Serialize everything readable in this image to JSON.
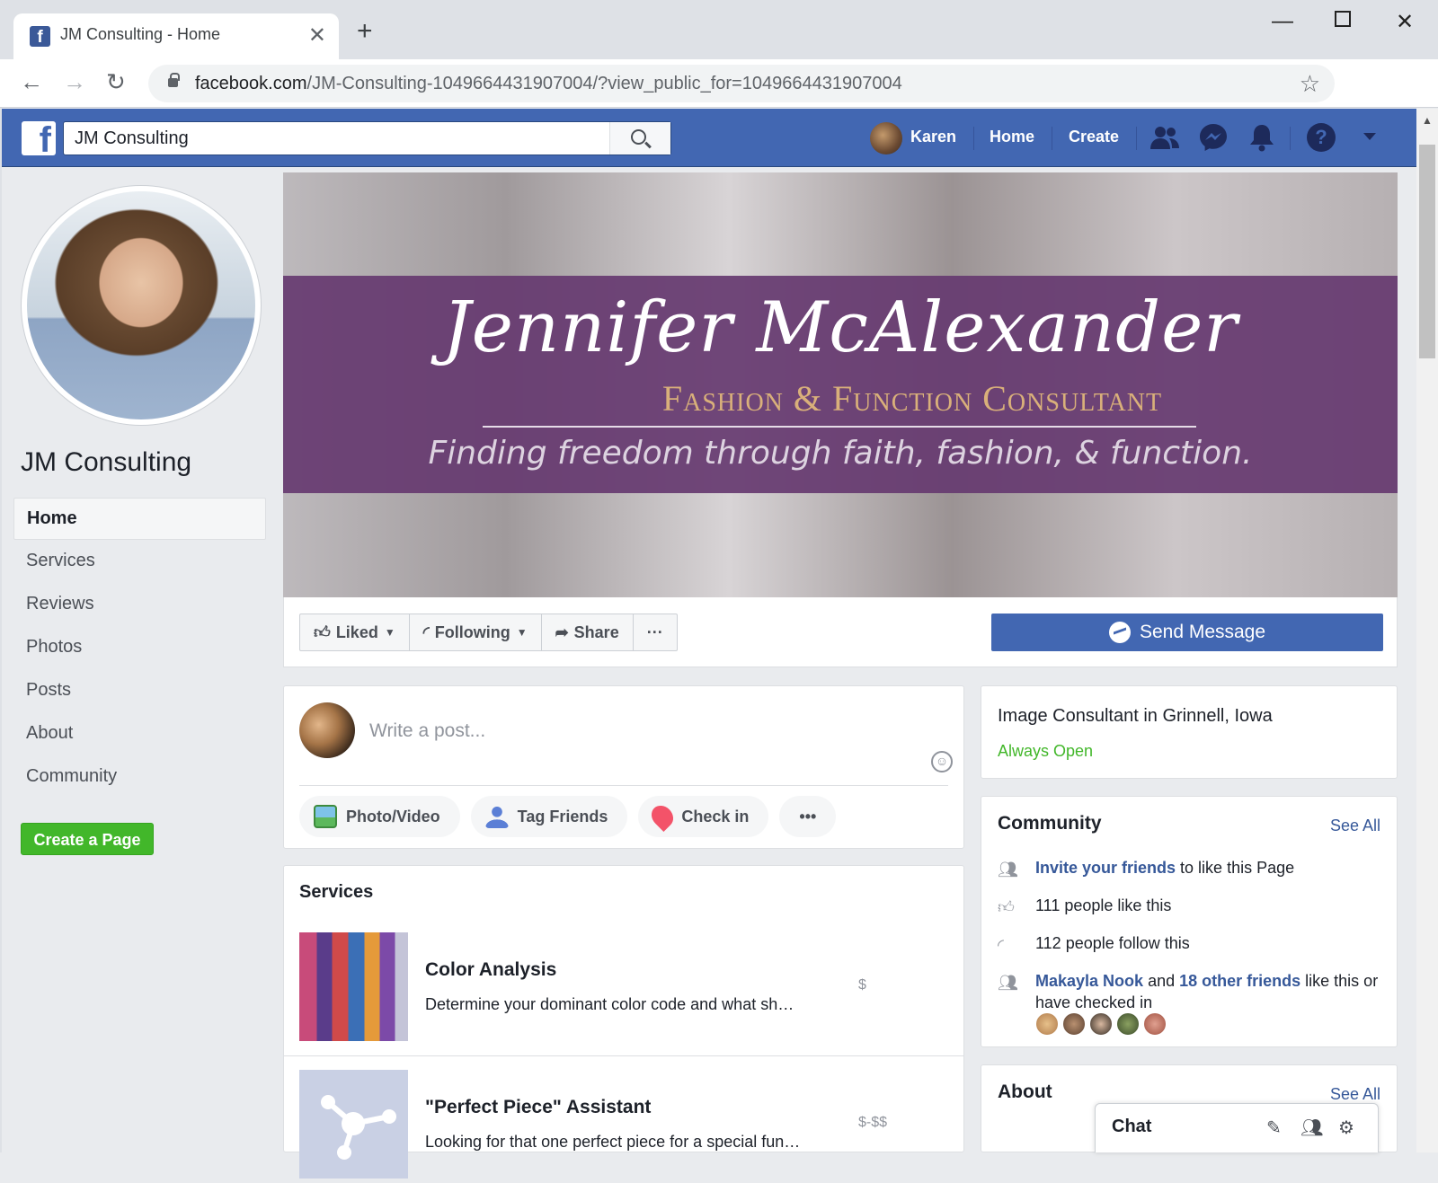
{
  "browser": {
    "tab_title": "JM Consulting - Home",
    "new_tab": "+",
    "url_host": "facebook.com",
    "url_path": "/JM-Consulting-1049664431907004/?view_public_for=1049664431907004"
  },
  "fb_header": {
    "search_value": "JM Consulting",
    "user_name": "Karen",
    "home": "Home",
    "create": "Create",
    "help": "?"
  },
  "page": {
    "name": "JM Consulting",
    "nav": [
      "Home",
      "Services",
      "Reviews",
      "Photos",
      "Posts",
      "About",
      "Community"
    ],
    "create_page": "Create a Page"
  },
  "cover": {
    "script_name": "Jennifer McAlexander",
    "subtitle": "Fashion & Function Consultant",
    "tagline": "Finding freedom through faith, fashion, & function."
  },
  "actions": {
    "liked": "Liked",
    "following": "Following",
    "share": "Share",
    "more": "···",
    "send_message": "Send Message"
  },
  "composer": {
    "placeholder": "Write a post...",
    "photo_video": "Photo/Video",
    "tag_friends": "Tag Friends",
    "check_in": "Check in",
    "more": "•••"
  },
  "services": {
    "heading": "Services",
    "items": [
      {
        "name": "Color Analysis",
        "desc": "Determine your dominant color code and what sh…",
        "price": "$"
      },
      {
        "name": "\"Perfect Piece\" Assistant",
        "desc": "Looking for that one perfect piece for a special fun…",
        "price": "$-$$"
      }
    ]
  },
  "info": {
    "category": "Image Consultant in Grinnell, Iowa",
    "hours": "Always Open"
  },
  "community": {
    "heading": "Community",
    "see_all": "See All",
    "invite_link": "Invite your friends",
    "invite_rest": " to like this Page",
    "likes": "111 people like this",
    "follows": "112 people follow this",
    "friend1": "Makayla Nook",
    "and": " and ",
    "others": "18 other friends",
    "friends_rest": " like this or have checked in"
  },
  "about": {
    "heading": "About",
    "see_all": "See All"
  },
  "chat": {
    "label": "Chat"
  },
  "colors": {
    "fb_blue": "#4267b2",
    "link_blue": "#365899",
    "green": "#42b72a",
    "cover_band": "#663a70",
    "cover_gold": "#d9b07a"
  }
}
